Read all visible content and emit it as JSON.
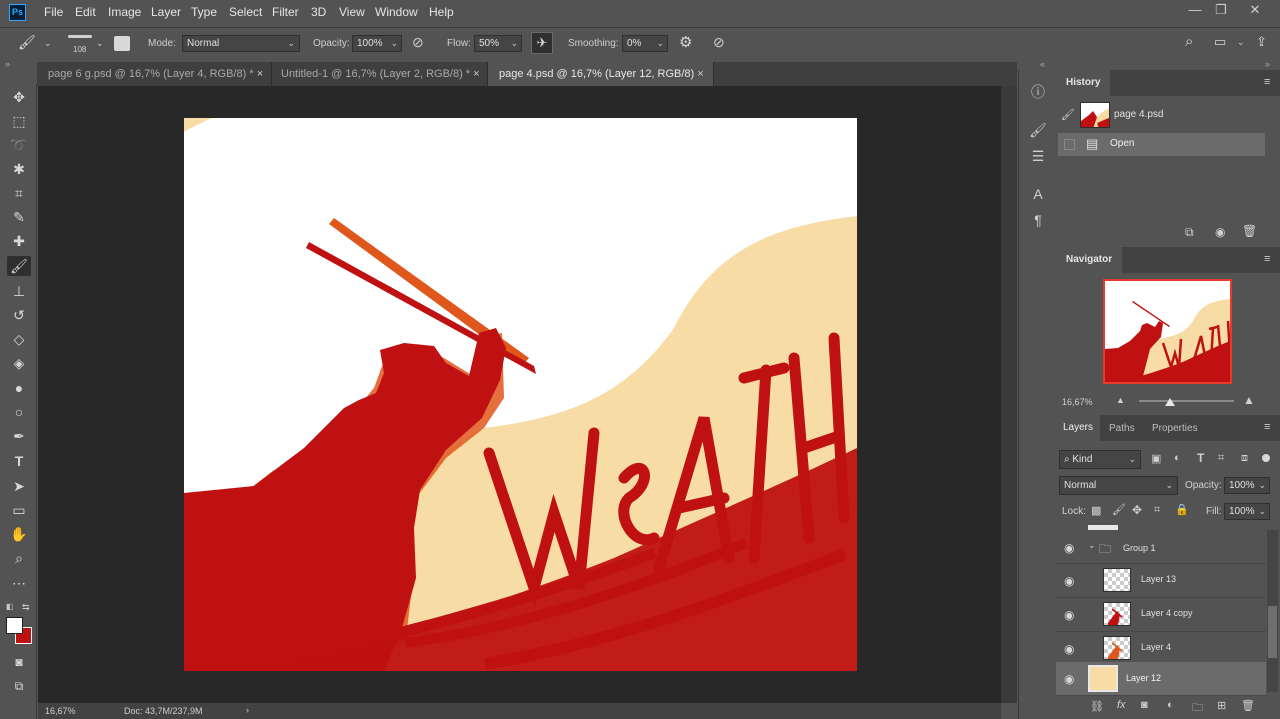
{
  "app": {
    "logo": "Ps"
  },
  "menu": [
    "File",
    "Edit",
    "Image",
    "Layer",
    "Type",
    "Select",
    "Filter",
    "3D",
    "View",
    "Window",
    "Help"
  ],
  "window_controls": {
    "minimize": "—",
    "restore": "❐",
    "close": "✕"
  },
  "options": {
    "brush_size": "108",
    "mode_label": "Mode:",
    "mode_value": "Normal",
    "opacity_label": "Opacity:",
    "opacity_value": "100%",
    "flow_label": "Flow:",
    "flow_value": "50%",
    "smoothing_label": "Smoothing:",
    "smoothing_value": "0%"
  },
  "tabs": [
    {
      "label": "page 6 g.psd @ 16,7% (Layer 4, RGB/8) *",
      "close": "×"
    },
    {
      "label": "Untitled-1 @ 16,7% (Layer 2, RGB/8) *",
      "close": "×"
    },
    {
      "label": "page 4.psd @ 16,7% (Layer 12, RGB/8)",
      "close": "×"
    }
  ],
  "status": {
    "zoom": "16,67%",
    "doc": "Doc: 43,7M/237,9M",
    "arrow": "›"
  },
  "history": {
    "title": "History",
    "snapshot": "page 4.psd",
    "items": [
      "Open"
    ]
  },
  "navigator": {
    "title": "Navigator",
    "zoom": "16,67%",
    "zoom_level": 0.33
  },
  "layers_panel": {
    "tabs": [
      "Layers",
      "Paths",
      "Properties"
    ],
    "filter_kind": "Kind",
    "blend_mode": "Normal",
    "opacity_label": "Opacity:",
    "opacity_value": "100%",
    "lock_label": "Lock:",
    "fill_label": "Fill:",
    "fill_value": "100%",
    "group": "Group 1",
    "layers": [
      "Layer 13",
      "Layer 4 copy",
      "Layer 4",
      "Layer 12"
    ]
  },
  "colors": {
    "artwork_red": "#bf1111",
    "cream": "#f7dca6",
    "orange": "#e0571c"
  }
}
